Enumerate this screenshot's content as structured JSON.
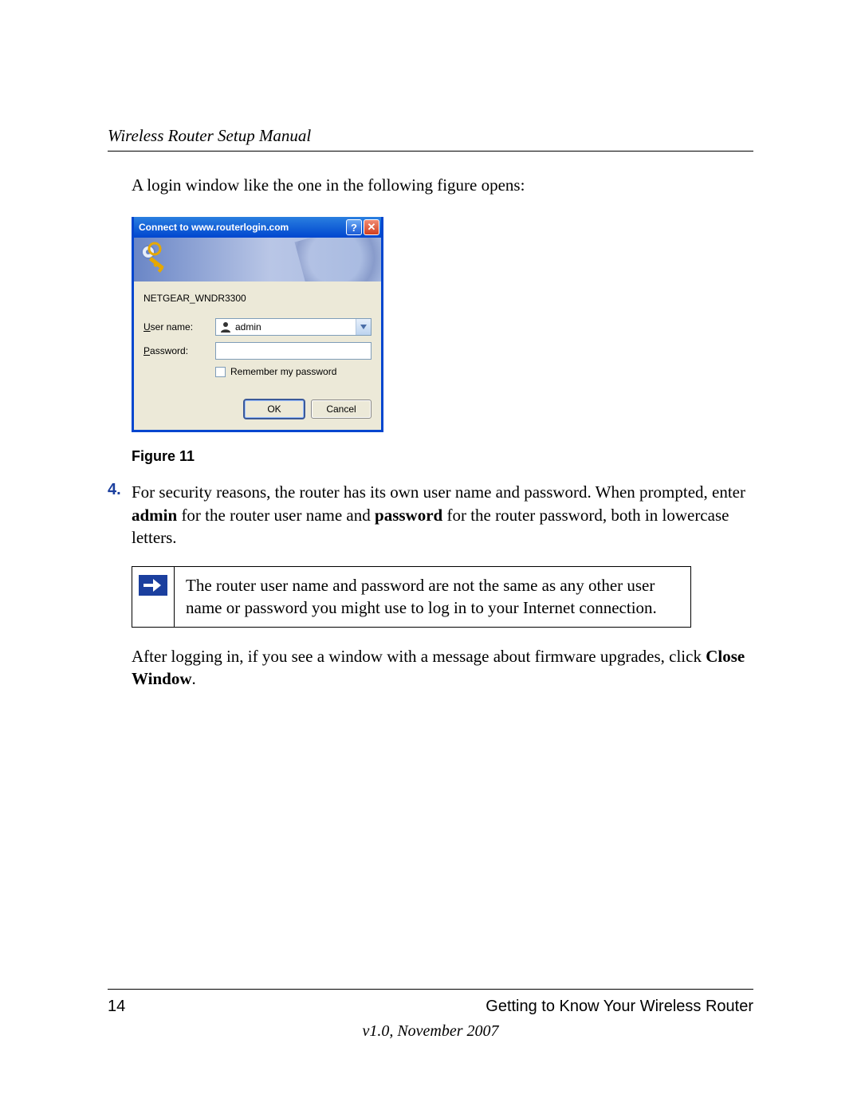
{
  "header": {
    "doc_title": "Wireless Router Setup Manual"
  },
  "intro_text": "A login window like the one in the following figure opens:",
  "dialog": {
    "title": "Connect to www.routerlogin.com",
    "help_symbol": "?",
    "close_symbol": "✕",
    "realm": "NETGEAR_WNDR3300",
    "username_label_pre": "U",
    "username_label_post": "ser name:",
    "username_value": "admin",
    "password_label_pre": "P",
    "password_label_post": "assword:",
    "password_value": "",
    "remember_pre": "R",
    "remember_post": "emember my password",
    "ok_label": "OK",
    "cancel_label": "Cancel"
  },
  "figure_caption": "Figure 11",
  "step4": {
    "num": "4.",
    "text_1": "For security reasons, the router has its own user name and password. When prompted, enter ",
    "bold_1": "admin",
    "text_2": " for the router user name and ",
    "bold_2": "password",
    "text_3": " for the router password, both in lowercase letters."
  },
  "note_text": "The router user name and password are not the same as any other user name or password you might use to log in to your Internet connection.",
  "after_note": {
    "text_1": "After logging in, if you see a window with a message about firmware upgrades, click ",
    "bold_1": "Close Window",
    "text_2": "."
  },
  "footer": {
    "page_num": "14",
    "section": "Getting to Know Your Wireless Router",
    "version": "v1.0, November 2007"
  }
}
